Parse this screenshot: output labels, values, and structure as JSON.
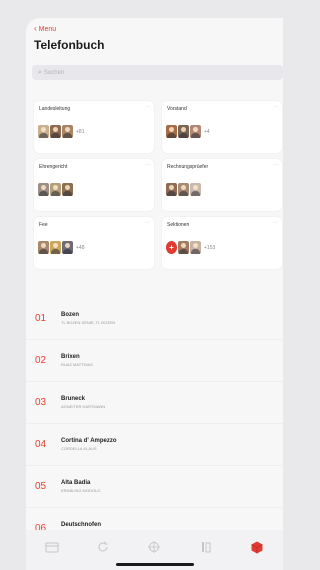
{
  "header": {
    "back_label": "Menu",
    "title": "Telefonbuch",
    "search_placeholder": "Suchen"
  },
  "groups": [
    {
      "title": "Landesleitung",
      "count": "+81",
      "avatars": [
        "#c9b08e",
        "#8f6a52",
        "#a88567"
      ]
    },
    {
      "title": "Vorstand",
      "count": "+4",
      "avatars": [
        "#a56d46",
        "#7a6555",
        "#b08878"
      ]
    },
    {
      "title": "Ehrengericht",
      "count": "",
      "avatars": [
        "#9b8f86",
        "#b49f7c",
        "#8a6f55"
      ]
    },
    {
      "title": "Rechnungsprüefer",
      "count": "",
      "avatars": [
        "#8e6b55",
        "#a48c74",
        "#c9b9b0"
      ]
    },
    {
      "title": "Fee",
      "count": "+48",
      "avatars": [
        "#a5896c",
        "#c9a75e",
        "#6e6a76"
      ]
    },
    {
      "title": "Sektionen",
      "count": "+153",
      "avatars": [
        "#a37d62",
        "#c6b3a3"
      ]
    }
  ],
  "sections": [
    {
      "num": "01",
      "name": "Bozen",
      "sub": "TL BOZEN SENIE, TL BOZEN"
    },
    {
      "num": "02",
      "name": "Brixen",
      "sub": "RUAZ MATTHIAS"
    },
    {
      "num": "03",
      "name": "Bruneck",
      "sub": "AGNEITER HARTMANN"
    },
    {
      "num": "04",
      "name": "Cortina d' Ampezzo",
      "sub": "CORDELLA KLAUS"
    },
    {
      "num": "05",
      "name": "Alta Badia",
      "sub": "ERNBLING MODOLO"
    },
    {
      "num": "06",
      "name": "Deutschnofen",
      "sub": "HANGER GERHARD"
    }
  ],
  "tabbar": {
    "icons": [
      "calendar-icon",
      "refresh-icon",
      "compass-icon",
      "book-icon",
      "cube-icon"
    ],
    "active_color": "#e13a33",
    "inactive_color": "#c5c5ca"
  },
  "colors": {
    "accent": "#e8412f"
  }
}
